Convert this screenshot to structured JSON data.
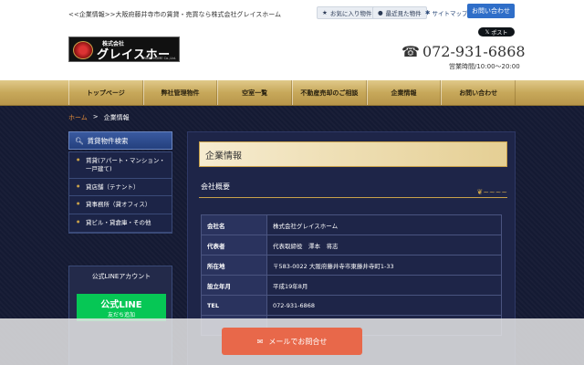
{
  "header": {
    "tagline": "<<企業情報>>大阪府藤井寺市の賃貸・売買なら株式会社グレイスホーム",
    "favorites_label": "お気に入り物件",
    "recent_label": "最近見た物件",
    "sitemap_label": "サイトマップ",
    "contact_label": "お問い合わせ",
    "x_post_label": "ポスト",
    "logo_small": "株式会社",
    "logo_main": "グレイスホーム",
    "logo_en": "GRACE HOME Co.,Ltd.",
    "phone": "072-931-6868",
    "hours": "営業時間/10:00〜20:00"
  },
  "nav": {
    "items": [
      "トップページ",
      "弊社管理物件",
      "空室一覧",
      "不動産売却のご相談",
      "企業情報",
      "お問い合わせ"
    ]
  },
  "breadcrumb": {
    "home": "ホーム",
    "sep": ">",
    "current": "企業情報"
  },
  "sidebar": {
    "search_title": "賃貸物件検索",
    "items": [
      "賃貸(アパート・マンション・一戸建て)",
      "貸店舗（テナント）",
      "貸事務所（貸オフィス）",
      "貸ビル・貸倉庫・その他"
    ],
    "line_title": "公式LINEアカウント",
    "line_banner_1": "公式LINE",
    "line_banner_2": "友だち追加"
  },
  "content": {
    "title": "企業情報",
    "section": "会社概要",
    "rows": [
      {
        "key": "会社名",
        "value": "株式会社グレイスホーム"
      },
      {
        "key": "代表者",
        "value": "代表取締役　澤本　将志"
      },
      {
        "key": "所在地",
        "value": "〒583-0022 大阪府藤井寺市東藤井寺町1-33"
      },
      {
        "key": "設立年月",
        "value": "平成19年8月"
      },
      {
        "key": "TEL",
        "value": "072-931-6868"
      },
      {
        "key": "",
        "value": ""
      }
    ]
  },
  "float": {
    "mail_label": "メールでお問合せ"
  },
  "colors": {
    "nav_gold": "#c7a85a",
    "navy": "#141a33",
    "mail_orange": "#e8684a",
    "contact_blue": "#2f6ec8"
  }
}
